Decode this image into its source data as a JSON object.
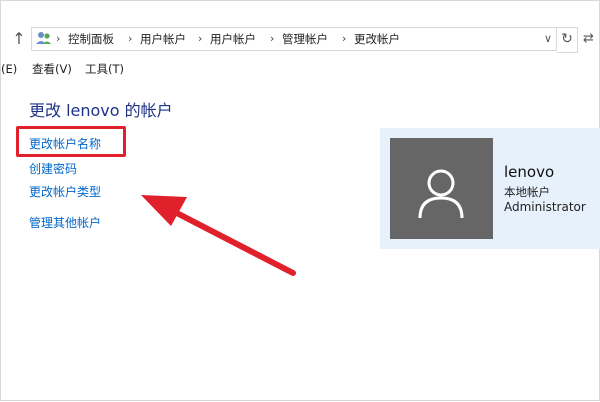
{
  "address_bar": {
    "breadcrumbs": [
      "控制面板",
      "用户帐户",
      "用户帐户",
      "管理帐户",
      "更改帐户"
    ],
    "icon": "users-control-panel-icon"
  },
  "menu": {
    "edit_label": "(E)",
    "view_label": "查看(V)",
    "tools_label": "工具(T)"
  },
  "main": {
    "title": "更改 lenovo 的帐户",
    "links": [
      "更改帐户名称",
      "创建密码",
      "更改帐户类型",
      "管理其他帐户"
    ]
  },
  "account": {
    "name": "lenovo",
    "type": "本地帐户",
    "role": "Administrator"
  },
  "colors": {
    "title": "#1e3287",
    "link": "#0066cc",
    "highlight": "#e0202a",
    "panel_bg": "#e6f1fb",
    "avatar_bg": "#666666"
  }
}
